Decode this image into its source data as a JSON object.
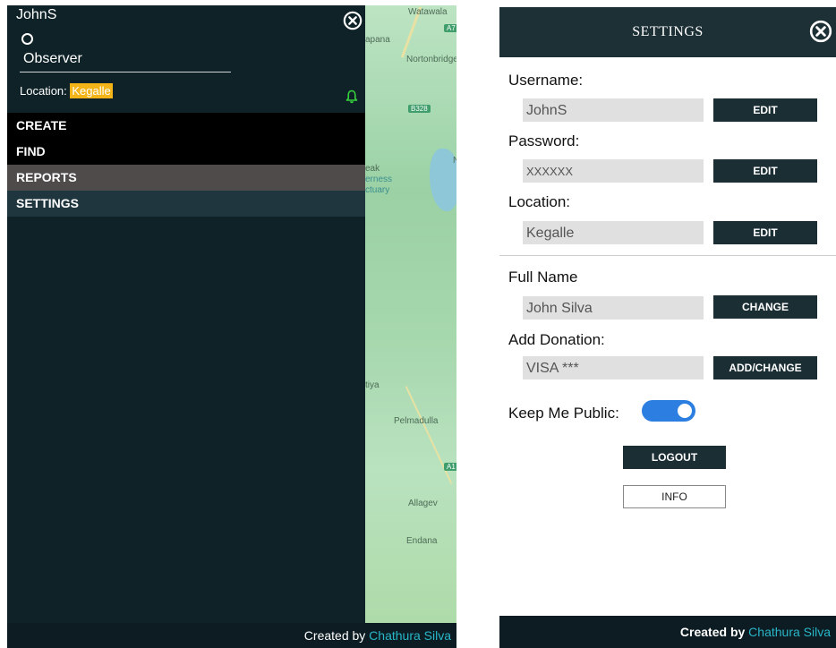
{
  "left": {
    "username": "JohnS",
    "role": "Observer",
    "location_label": "Location:",
    "location_value": "Kegalle",
    "nav": [
      {
        "label": "CREATE"
      },
      {
        "label": "FIND"
      },
      {
        "label": "REPORTS"
      },
      {
        "label": "SETTINGS"
      }
    ],
    "map_labels": {
      "watawala": "Watawala",
      "apana": "apana",
      "nortonbridge": "Nortonbridge",
      "b328": "B328",
      "eak": "eak",
      "erness": "erness",
      "ctuary": "ctuary",
      "n": "N",
      "tiya": "tiya",
      "pelmadulla": "Pelmadulla",
      "a7": "A7",
      "a1": "A1",
      "allage": "Allagev",
      "endana": "Endana"
    },
    "footer_prefix": "Created by",
    "footer_author": "Chathura Silva"
  },
  "settings": {
    "title": "SETTINGS",
    "fields": [
      {
        "label": "Username:",
        "value": "JohnS",
        "button": "EDIT"
      },
      {
        "label": "Password:",
        "value": "XXXXXX",
        "button": "EDIT"
      },
      {
        "label": "Location:",
        "value": "Kegalle",
        "button": "EDIT"
      },
      {
        "label": "Full Name",
        "value": "John Silva",
        "button": "CHANGE"
      },
      {
        "label": "Add Donation:",
        "value": "VISA ***",
        "button": "ADD/CHANGE"
      }
    ],
    "public_label": "Keep Me Public:",
    "public_on": true,
    "logout": "LOGOUT",
    "info": "INFO",
    "footer_prefix": "Created by",
    "footer_author": "Chathura Silva"
  },
  "colors": {
    "drawer_bg": "#0f2228",
    "accent_yellow": "#f4b417",
    "bell_green": "#37d33c",
    "toggle_blue": "#2c7fe0",
    "author_teal": "#29b6c8"
  },
  "icons": [
    "close-icon",
    "bell-icon",
    "loading-ring-icon"
  ]
}
